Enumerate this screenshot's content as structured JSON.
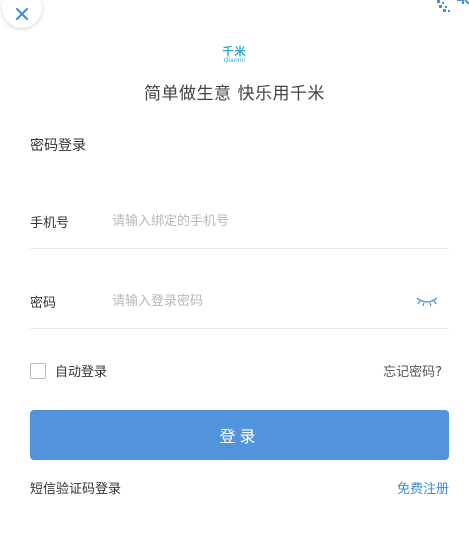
{
  "logo": {
    "cn": "千米",
    "en": "Qianmi"
  },
  "slogan": "简单做生意 快乐用千米",
  "form": {
    "title": "密码登录",
    "phone_label": "手机号",
    "phone_placeholder": "请输入绑定的手机号",
    "password_label": "密码",
    "password_placeholder": "请输入登录密码",
    "remember_label": "自动登录",
    "remember_checked": false,
    "forgot_label": "忘记密码?",
    "submit_label": "登录",
    "sms_login_label": "短信验证码登录",
    "register_label": "免费注册"
  },
  "icons": {
    "close": "close-icon",
    "qr": "qr-code-icon",
    "password_visibility": "eye-closed-icon"
  },
  "colors": {
    "brand": "#27a7d6",
    "primary_button": "#5193dd",
    "link": "#3b8fd6",
    "placeholder": "#b8b8b8",
    "close_icon": "#3a8ee6"
  }
}
